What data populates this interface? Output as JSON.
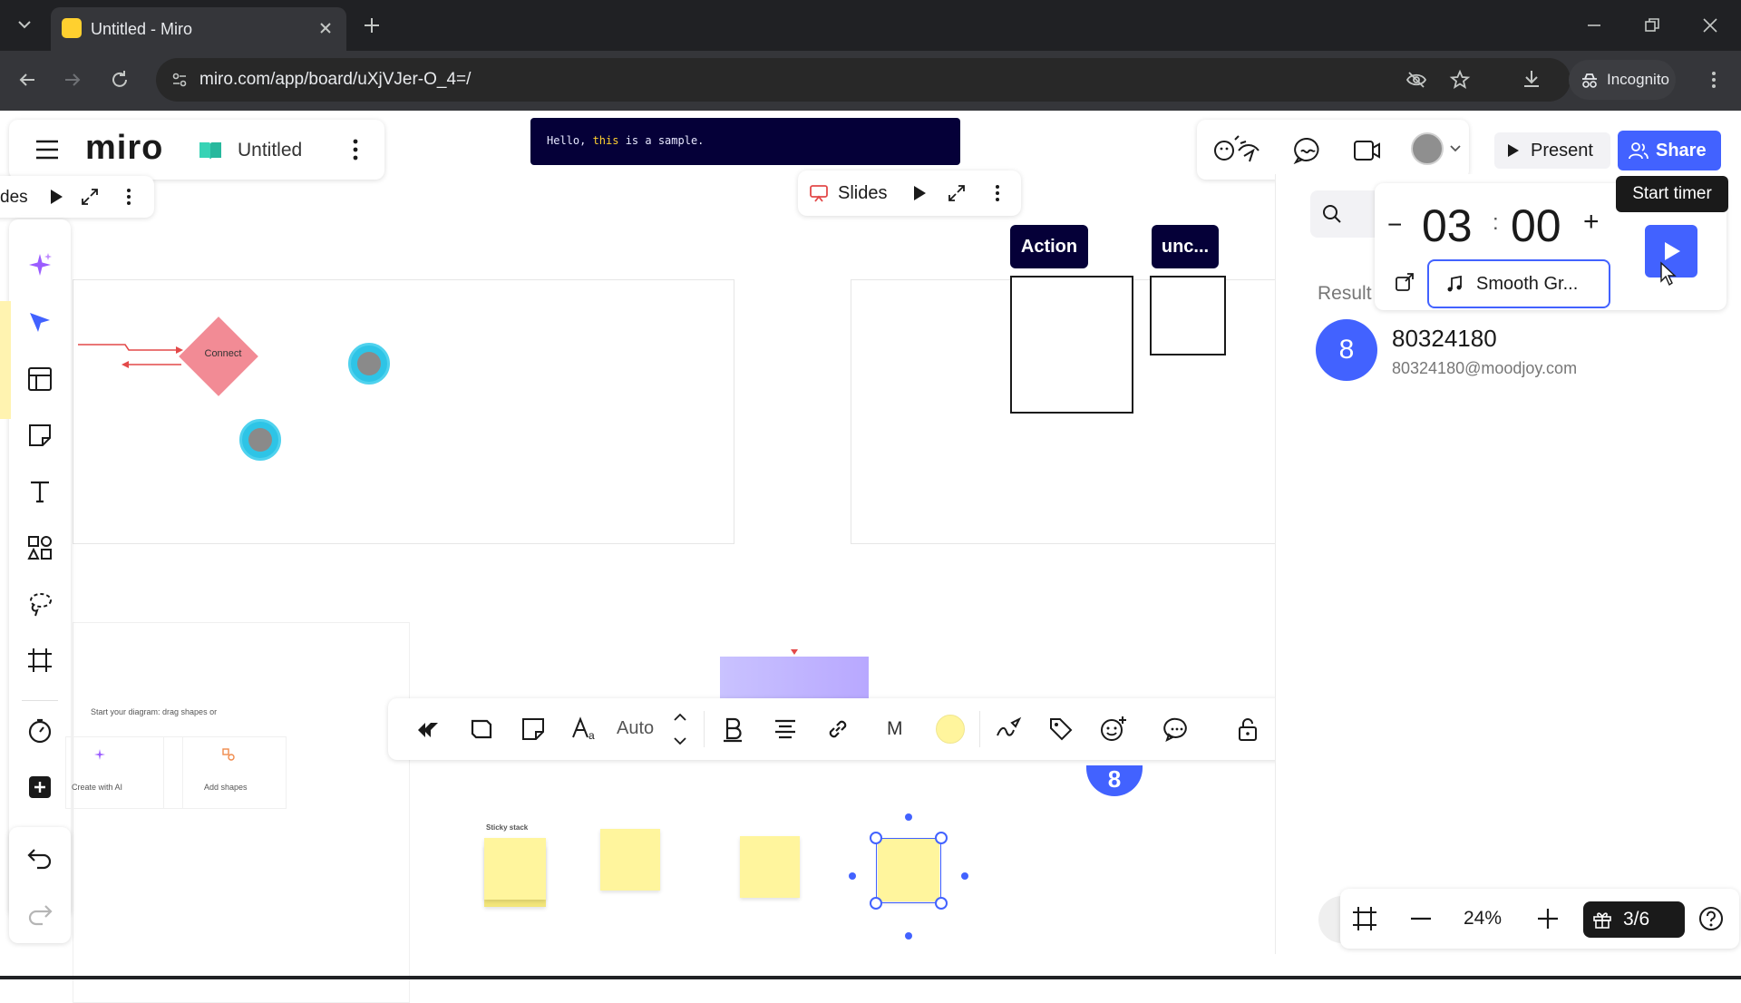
{
  "browser": {
    "tab_title": "Untitled - Miro",
    "url": "miro.com/app/board/uXjVJer-O_4=/",
    "incognito_label": "Incognito"
  },
  "header": {
    "logo": "miro",
    "board_title": "Untitled",
    "present_label": "Present",
    "share_label": "Share"
  },
  "banner": {
    "before": "Hello, ",
    "highlight": "this",
    "after": " is a sample."
  },
  "slides_bar": {
    "label": "Slides",
    "left_fragment": "des"
  },
  "canvas": {
    "connect_label": "Connect",
    "action_label": "Action",
    "unc_label": "unc...",
    "diagram_hint": "Start your diagram: drag shapes or",
    "create_ai_label": "Create with AI",
    "add_shapes_label": "Add shapes",
    "sticky_stack_label": "Sticky stack",
    "cursor_badge": "8"
  },
  "toolbar": {
    "auto_label": "Auto",
    "m_label": "M",
    "fill_color": "#fff59d"
  },
  "timer": {
    "tooltip": "Start timer",
    "minutes": "03",
    "colon": ":",
    "seconds": "00",
    "minus": "−",
    "plus": "+",
    "music_label": "Smooth Gr..."
  },
  "search_panel": {
    "results_label": "Result",
    "result_avatar": "8",
    "result_name": "80324180",
    "result_email": "80324180@moodjoy.com"
  },
  "bottom": {
    "zoom": "24%",
    "pages": "3/6"
  },
  "colors": {
    "accent": "#4262ff",
    "share_bg": "#4262ff",
    "sticky": "#fff59d",
    "diamond": "#f28b95",
    "navy": "#050038"
  }
}
